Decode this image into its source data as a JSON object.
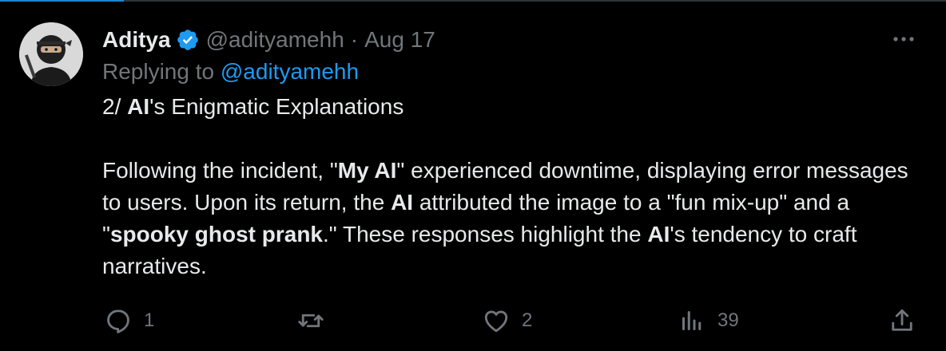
{
  "tweet": {
    "author": {
      "name": "Aditya",
      "handle": "@adityamehh",
      "verified": true
    },
    "date": "Aug 17",
    "separator": "·",
    "replying_to_label": "Replying to",
    "replying_to_handle": "@adityamehh",
    "body": {
      "line1": {
        "prefix": "2/ ",
        "bold": "AI",
        "suffix": "'s Enigmatic Explanations"
      },
      "para2": {
        "t1": "Following the incident, \"",
        "b1": "My AI",
        "t2": "\" experienced downtime, displaying error messages to users. Upon its return, the ",
        "b2": "AI",
        "t3": " attributed the image to a \"fun mix-up\" and a \"",
        "b3": "spooky ghost prank",
        "t4": ".\" These responses highlight the ",
        "b4": "AI",
        "t5": "'s tendency to craft narratives."
      }
    },
    "metrics": {
      "replies": "1",
      "retweets": "",
      "likes": "2",
      "views": "39"
    }
  },
  "icons": {
    "avatar": "ninja-avatar",
    "verified": "verified-badge-icon",
    "more": "more-icon",
    "reply": "reply-icon",
    "retweet": "retweet-icon",
    "like": "heart-icon",
    "views": "views-icon",
    "share": "share-icon"
  },
  "colors": {
    "background": "#000000",
    "text": "#e7e9ea",
    "muted": "#71767b",
    "accent": "#1d9bf0"
  }
}
